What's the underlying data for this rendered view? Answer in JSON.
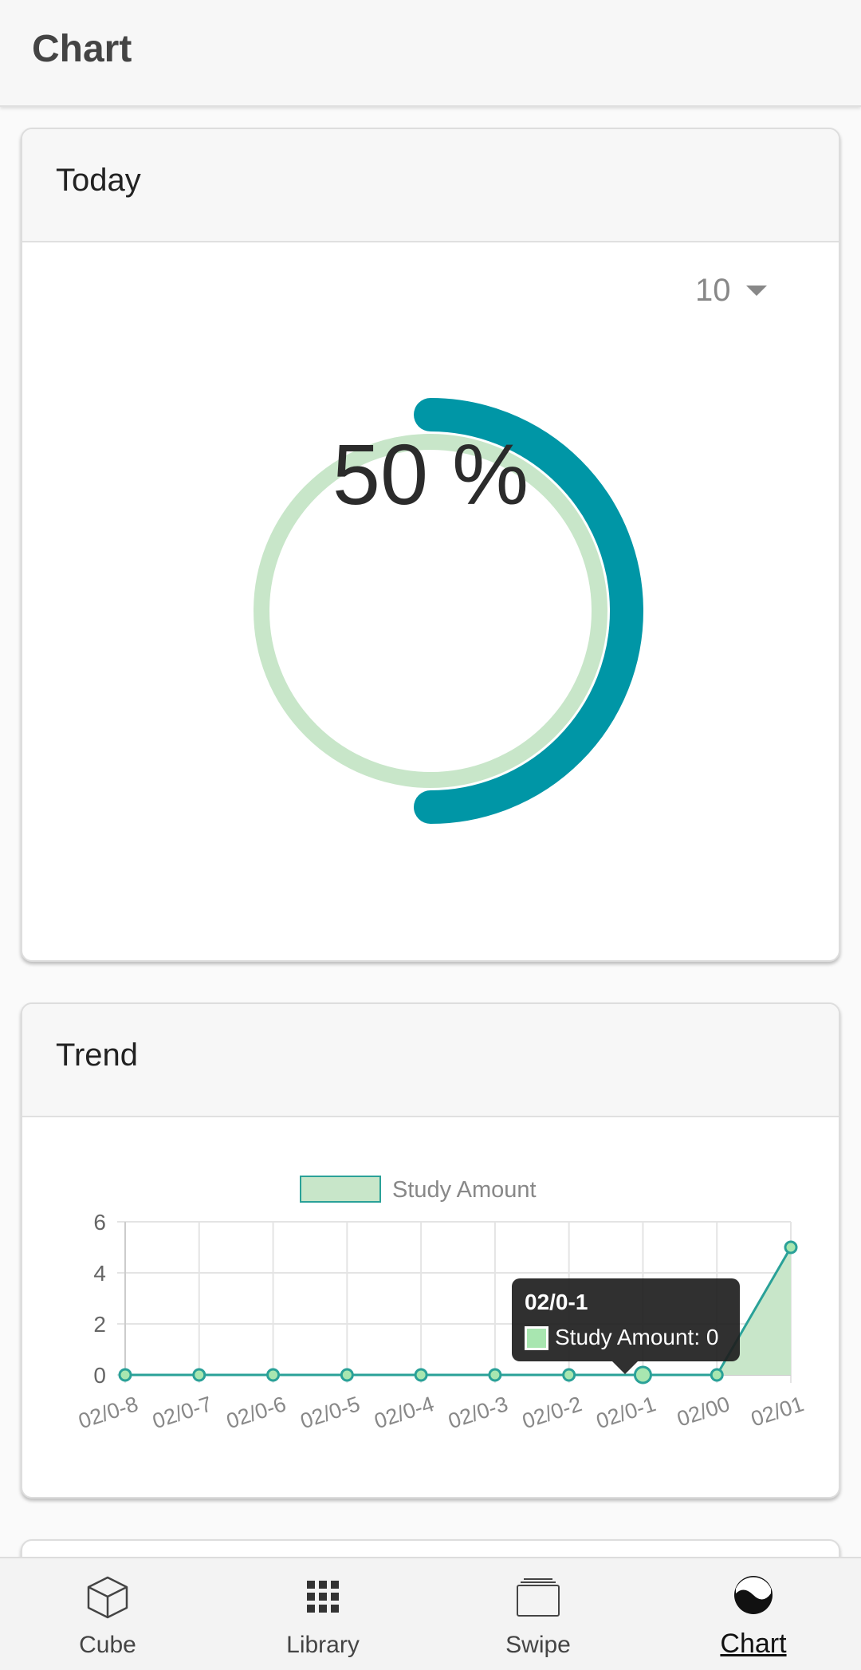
{
  "appbar": {
    "title": "Chart"
  },
  "today": {
    "title": "Today",
    "select_value": "10",
    "progress_text": "50 %",
    "progress_fraction": 0.5,
    "colors": {
      "progress": "#0096a6",
      "track": "#c8e6c9"
    }
  },
  "trend": {
    "title": "Trend",
    "chart_data": {
      "type": "area",
      "categories": [
        "02/0-8",
        "02/0-7",
        "02/0-6",
        "02/0-5",
        "02/0-4",
        "02/0-3",
        "02/0-2",
        "02/0-1",
        "02/00",
        "02/01"
      ],
      "series": [
        {
          "name": "Study Amount",
          "values": [
            0,
            0,
            0,
            0,
            0,
            0,
            0,
            0,
            0,
            5
          ]
        }
      ],
      "ylim": [
        0,
        6
      ],
      "yticks": [
        "0",
        "2",
        "4",
        "6"
      ],
      "grid": true,
      "legend": "top",
      "colors": {
        "line": "#2aa198",
        "fill": "#c8e6c9",
        "point": "#a8e6b0"
      },
      "tooltip": {
        "title": "02/0-1",
        "text": "Study Amount: 0"
      }
    }
  },
  "nav": {
    "items": [
      {
        "label": "Cube",
        "icon": "cube-icon"
      },
      {
        "label": "Library",
        "icon": "grid-icon"
      },
      {
        "label": "Swipe",
        "icon": "cards-icon"
      },
      {
        "label": "Chart",
        "icon": "chart-wave-icon"
      }
    ],
    "active": "Chart"
  }
}
